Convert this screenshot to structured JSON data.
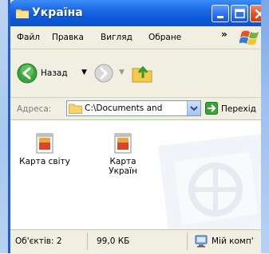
{
  "window": {
    "title": "Україна"
  },
  "menu": {
    "items": [
      "Файл",
      "Правка",
      "Вигляд",
      "Обране"
    ],
    "more": "»"
  },
  "toolbar": {
    "back_label": "Назад",
    "dropdown_glyph": "▼",
    "more": "»"
  },
  "address": {
    "label": "Адреса:",
    "value": "C:\\Documents and",
    "go_label": "Перехід"
  },
  "files": [
    {
      "label": "Карта світу"
    },
    {
      "label": "Карта Україн"
    }
  ],
  "status": {
    "objects": "Об'єктів: 2",
    "size": "99,0 КБ",
    "location": "Мій комп'"
  },
  "colors": {
    "titlebar": "#0d58d8",
    "chrome": "#f1efe2",
    "close": "#e0521f"
  }
}
